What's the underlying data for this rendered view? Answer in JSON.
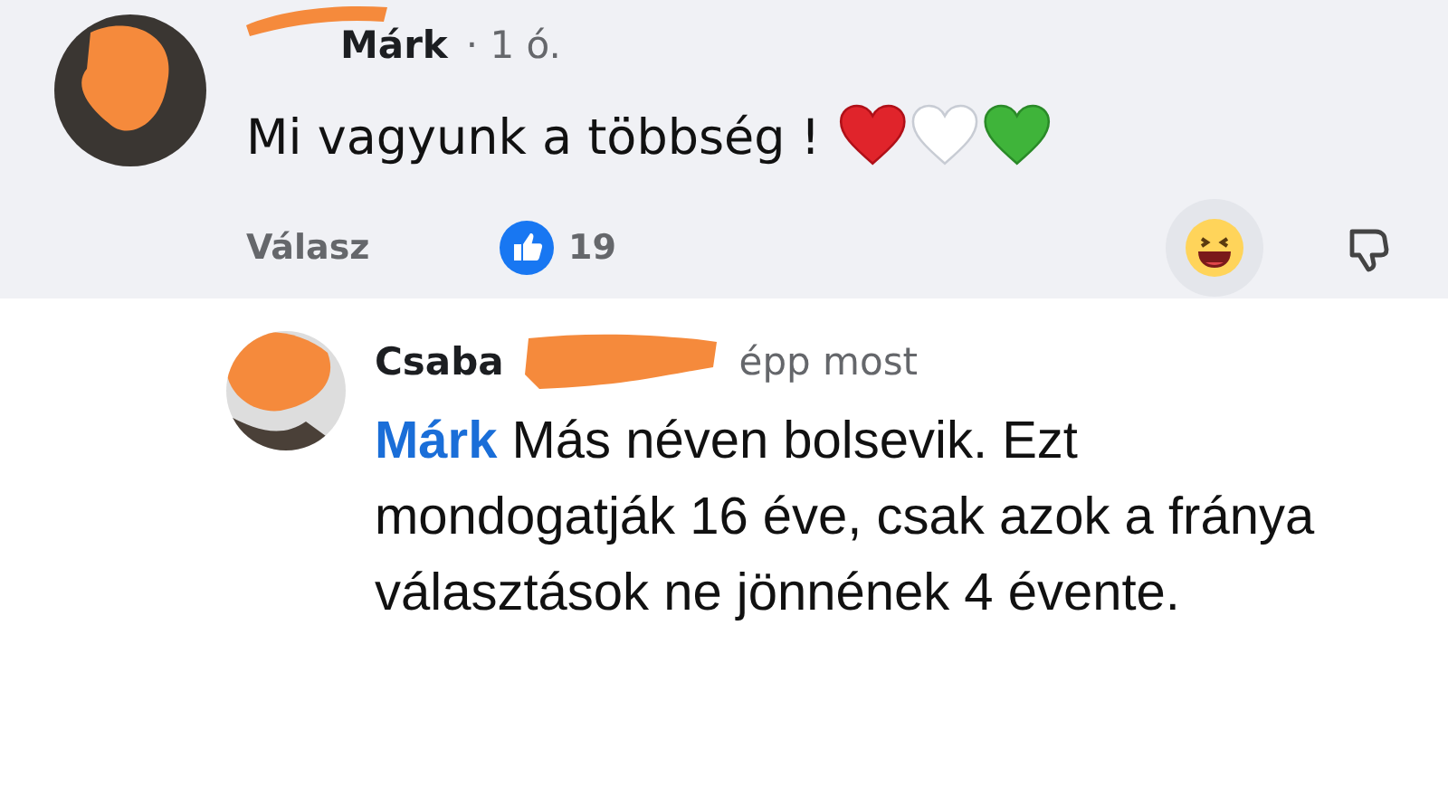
{
  "comment": {
    "author": "Márk",
    "time": "· 1 ó.",
    "text": "Mi vagyunk a többség !",
    "reply_action": "Válasz",
    "like_count": "19"
  },
  "reply": {
    "author": "Csaba",
    "time": "épp most",
    "mention": "Márk",
    "text": "Más néven bolsevik. Ezt mondogatják 16 éve, csak azok a fránya választások ne jönnének 4 évente."
  }
}
